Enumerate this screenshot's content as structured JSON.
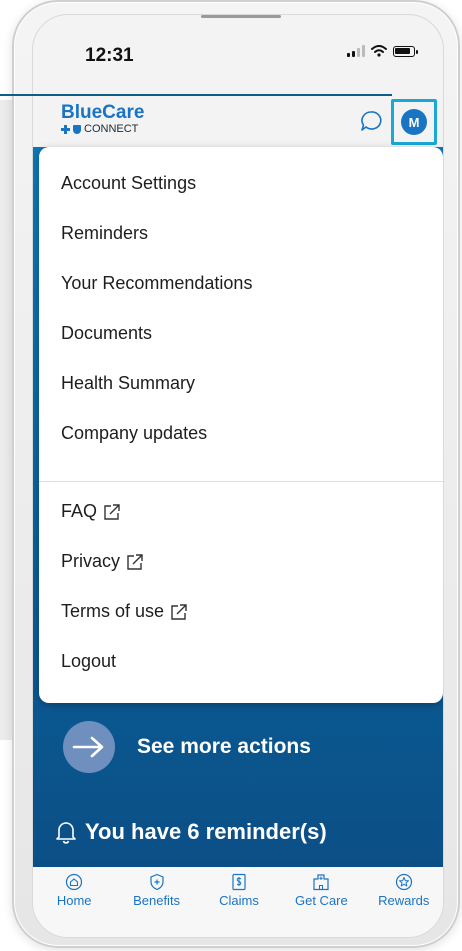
{
  "status_bar": {
    "time": "12:31"
  },
  "header": {
    "logo_title": "BlueCare",
    "logo_subtitle": "CONNECT",
    "avatar_initial": "M"
  },
  "menu": {
    "items": [
      {
        "label": "Account Settings"
      },
      {
        "label": "Reminders"
      },
      {
        "label": "Your Recommendations"
      },
      {
        "label": "Documents"
      },
      {
        "label": "Health Summary"
      },
      {
        "label": "Company updates"
      }
    ],
    "external_items": [
      {
        "label": "FAQ",
        "icon": "external-link-icon"
      },
      {
        "label": "Privacy",
        "icon": "external-link-icon"
      },
      {
        "label": "Terms of use",
        "icon": "external-link-icon"
      }
    ],
    "logout_label": "Logout"
  },
  "main": {
    "more_actions_label": "See more actions",
    "reminders_label": "You have 6 reminder(s)"
  },
  "bottom_nav": {
    "items": [
      {
        "label": "Home",
        "icon": "home-icon"
      },
      {
        "label": "Benefits",
        "icon": "shield-plus-icon"
      },
      {
        "label": "Claims",
        "icon": "dollar-document-icon"
      },
      {
        "label": "Get Care",
        "icon": "hospital-icon"
      },
      {
        "label": "Rewards",
        "icon": "star-badge-icon"
      }
    ]
  },
  "colors": {
    "brand_blue": "#1a74c4",
    "highlight": "#1aa8d6",
    "panel_blue": "#0d77b6"
  }
}
